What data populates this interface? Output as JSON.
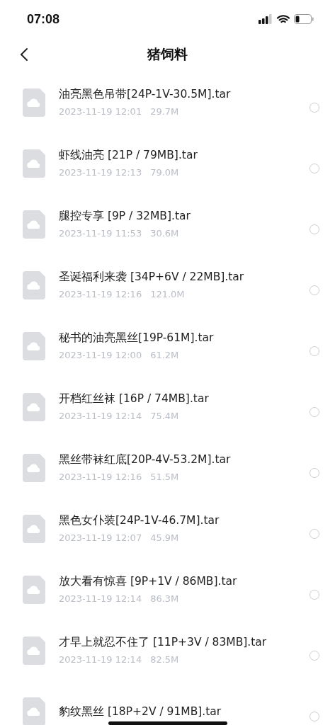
{
  "status_bar": {
    "time": "07:08"
  },
  "nav": {
    "title": "猪饲料"
  },
  "files": [
    {
      "name": "油亮黑色吊带[24P-1V-30.5M].tar",
      "date": "2023-11-19 12:01",
      "size": "29.7M",
      "selected": false
    },
    {
      "name": "虾线油亮 [21P / 79MB].tar",
      "date": "2023-11-19 12:13",
      "size": "79.0M",
      "selected": false
    },
    {
      "name": "腿控专享 [9P / 32MB].tar",
      "date": "2023-11-19 11:53",
      "size": "30.6M",
      "selected": false
    },
    {
      "name": "圣诞福利来袭 [34P+6V / 22MB].tar",
      "date": "2023-11-19 12:16",
      "size": "121.0M",
      "selected": false
    },
    {
      "name": "秘书的油亮黑丝[19P-61M].tar",
      "date": "2023-11-19 12:00",
      "size": "61.2M",
      "selected": false
    },
    {
      "name": "开档红丝袜 [16P / 74MB].tar",
      "date": "2023-11-19 12:14",
      "size": "75.4M",
      "selected": false
    },
    {
      "name": "黑丝带袜红底[20P-4V-53.2M].tar",
      "date": "2023-11-19 12:16",
      "size": "51.5M",
      "selected": false
    },
    {
      "name": "黑色女仆装[24P-1V-46.7M].tar",
      "date": "2023-11-19 12:07",
      "size": "45.9M",
      "selected": false
    },
    {
      "name": "放大看有惊喜 [9P+1V / 86MB].tar",
      "date": "2023-11-19 12:14",
      "size": "86.3M",
      "selected": false
    },
    {
      "name": "才早上就忍不住了 [11P+3V / 83MB].tar",
      "date": "2023-11-19 12:14",
      "size": "82.5M",
      "selected": false
    },
    {
      "name": "豹纹黑丝 [18P+2V / 91MB].tar",
      "selected": false
    }
  ]
}
